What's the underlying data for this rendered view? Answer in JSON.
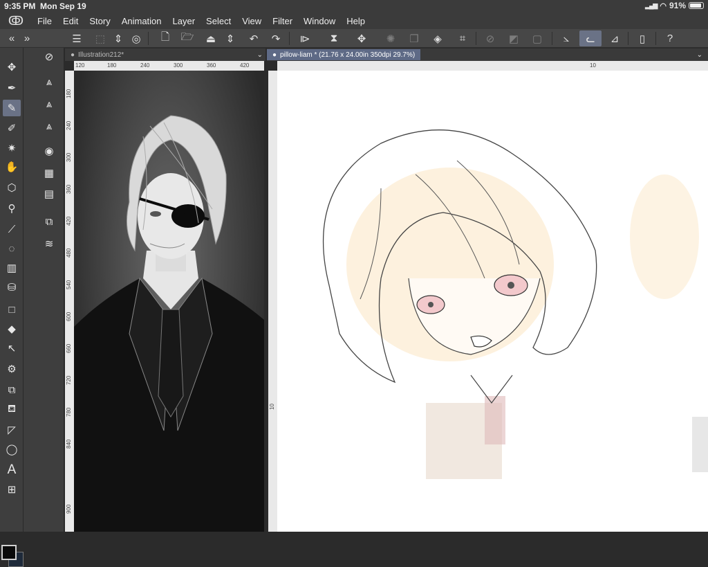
{
  "status": {
    "time": "9:35 PM",
    "date": "Mon Sep 19",
    "battery": "91%",
    "battery_level": 0.91
  },
  "menubar": {
    "items": [
      "File",
      "Edit",
      "Story",
      "Animation",
      "Layer",
      "Select",
      "View",
      "Filter",
      "Window",
      "Help"
    ]
  },
  "toolbar": {
    "icons": [
      "menu-icon",
      "transform-icon",
      "updown-icon",
      "spiral-icon",
      "new-file-icon",
      "open-folder-icon",
      "save-icon",
      "updown2-icon",
      "undo-icon",
      "redo-icon",
      "flip-horizontal-icon",
      "flip-vertical-icon",
      "move-icon",
      "loading-icon",
      "copy-icon",
      "fill-icon",
      "crop-icon",
      "disabled-a-icon",
      "disabled-b-icon",
      "disabled-c-icon",
      "ruler-pen-icon",
      "brush-active-icon",
      "ruler-icon",
      "tablet-icon",
      "help-icon"
    ]
  },
  "tools": [
    "move-icon",
    "pen-icon",
    "pencil-icon",
    "marker-icon",
    "sparkle-icon",
    "hand-icon",
    "object-icon",
    "zoom-icon",
    "eyedropper-icon",
    "lasso-icon",
    "gradient-icon",
    "fill-icon",
    "rectangle-icon",
    "eraser-icon",
    "select-icon",
    "settings-icon",
    "layers-icon",
    "bucket-icon",
    "triangle-icon",
    "speech-bubble-icon",
    "text-icon",
    "frame-icon"
  ],
  "subtools": [
    "navigator-icon",
    "layer-move-icon",
    "layer-prop-icon",
    "auto-action-icon",
    "material-icon",
    "timeline-icon",
    "film-icon",
    "layer-search-icon",
    "layers-stack-icon"
  ],
  "windows": {
    "left": {
      "title": "Illustration212*",
      "ruler_labels": [
        "120",
        "180",
        "240",
        "300",
        "360",
        "420"
      ],
      "vruler_labels": [
        "180",
        "240",
        "300",
        "360",
        "420",
        "480",
        "540",
        "600",
        "660",
        "720",
        "780",
        "840",
        "900"
      ]
    },
    "right": {
      "title": "pillow-liam * (21.76 x 24.00in 350dpi 29.7%)",
      "ruler_labels": [
        "10"
      ],
      "vruler_labels": [
        "10"
      ]
    }
  },
  "colors": {
    "foreground": "#0a0a0a",
    "background": "#1e2a3a",
    "accent": "#6a7286"
  }
}
